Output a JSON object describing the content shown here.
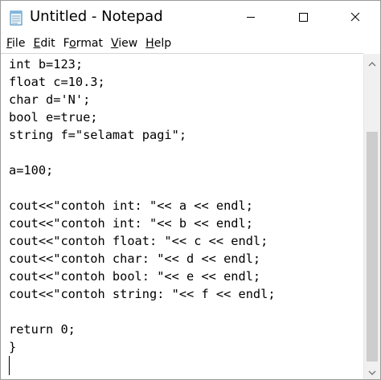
{
  "window": {
    "title": "Untitled - Notepad"
  },
  "menu": [
    {
      "label": "File"
    },
    {
      "label": "Edit"
    },
    {
      "label": "Format"
    },
    {
      "label": "View"
    },
    {
      "label": "Help"
    }
  ],
  "editor": {
    "lines": [
      "int b=123;",
      "float c=10.3;",
      "char d='N';",
      "bool e=true;",
      "string f=\"selamat pagi\";",
      "",
      "a=100;",
      "",
      "cout<<\"contoh int: \"<< a << endl;",
      "cout<<\"contoh int: \"<< b << endl;",
      "cout<<\"contoh float: \"<< c << endl;",
      "cout<<\"contoh char: \"<< d << endl;",
      "cout<<\"contoh bool: \"<< e << endl;",
      "cout<<\"contoh string: \"<< f << endl;",
      "",
      "return 0;",
      "}"
    ]
  },
  "icons": {
    "app": "notepad-icon",
    "minimize": "minimize-icon",
    "maximize": "maximize-icon",
    "close": "close-icon",
    "scroll_up": "chevron-up-icon",
    "scroll_down": "chevron-down-icon"
  },
  "colors": {
    "scrollbar_track": "#f0f0f0",
    "scrollbar_thumb": "#cdcdcd",
    "text": "#000000"
  }
}
